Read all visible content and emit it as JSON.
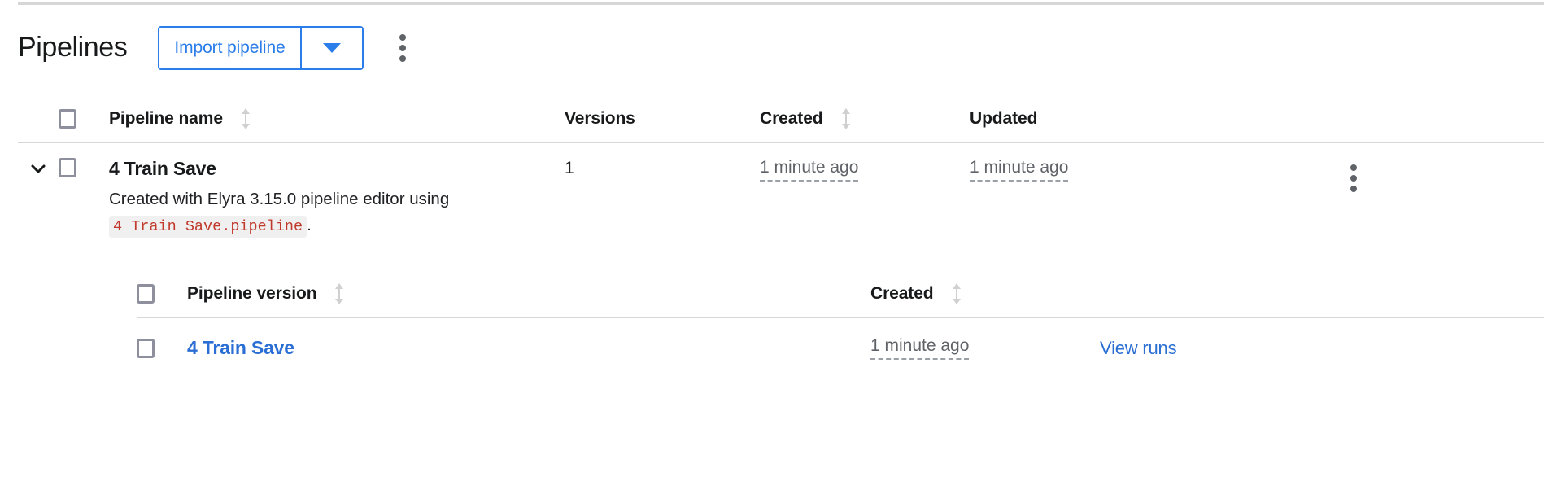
{
  "header": {
    "title": "Pipelines",
    "import_button_label": "Import pipeline",
    "import_dropdown_icon": "chevron-down-icon",
    "overflow_menu_icon": "kebab-menu-icon"
  },
  "colors": {
    "accent_blue": "#2b7de9",
    "link_blue": "#2b6fd4",
    "code_red": "#c0392b",
    "code_bg": "#f0f0f0",
    "muted_gray": "#5f6368",
    "divider": "#d8d8d8",
    "checkbox_border": "#8d8f9c"
  },
  "table": {
    "select_all_checkbox": "unchecked",
    "columns": [
      {
        "label": "Pipeline name",
        "sortable": true
      },
      {
        "label": "Versions",
        "sortable": false
      },
      {
        "label": "Created",
        "sortable": true
      },
      {
        "label": "Updated",
        "sortable": false
      }
    ],
    "rows": [
      {
        "expanded": true,
        "expander_icon": "chevron-down-icon",
        "checkbox": "unchecked",
        "name": "4 Train Save",
        "description_prefix": "Created with Elyra 3.15.0 pipeline editor using",
        "description_code": "4 Train Save.pipeline",
        "description_suffix": ".",
        "versions": "1",
        "created": "1 minute ago",
        "updated": "1 minute ago",
        "row_menu_icon": "kebab-menu-icon"
      }
    ]
  },
  "nested_table": {
    "select_all_checkbox": "unchecked",
    "columns": [
      {
        "label": "Pipeline version",
        "sortable": true
      },
      {
        "label": "Created",
        "sortable": true
      }
    ],
    "rows": [
      {
        "checkbox": "unchecked",
        "version_name": "4 Train Save",
        "created": "1 minute ago",
        "view_runs_label": "View runs"
      }
    ]
  }
}
